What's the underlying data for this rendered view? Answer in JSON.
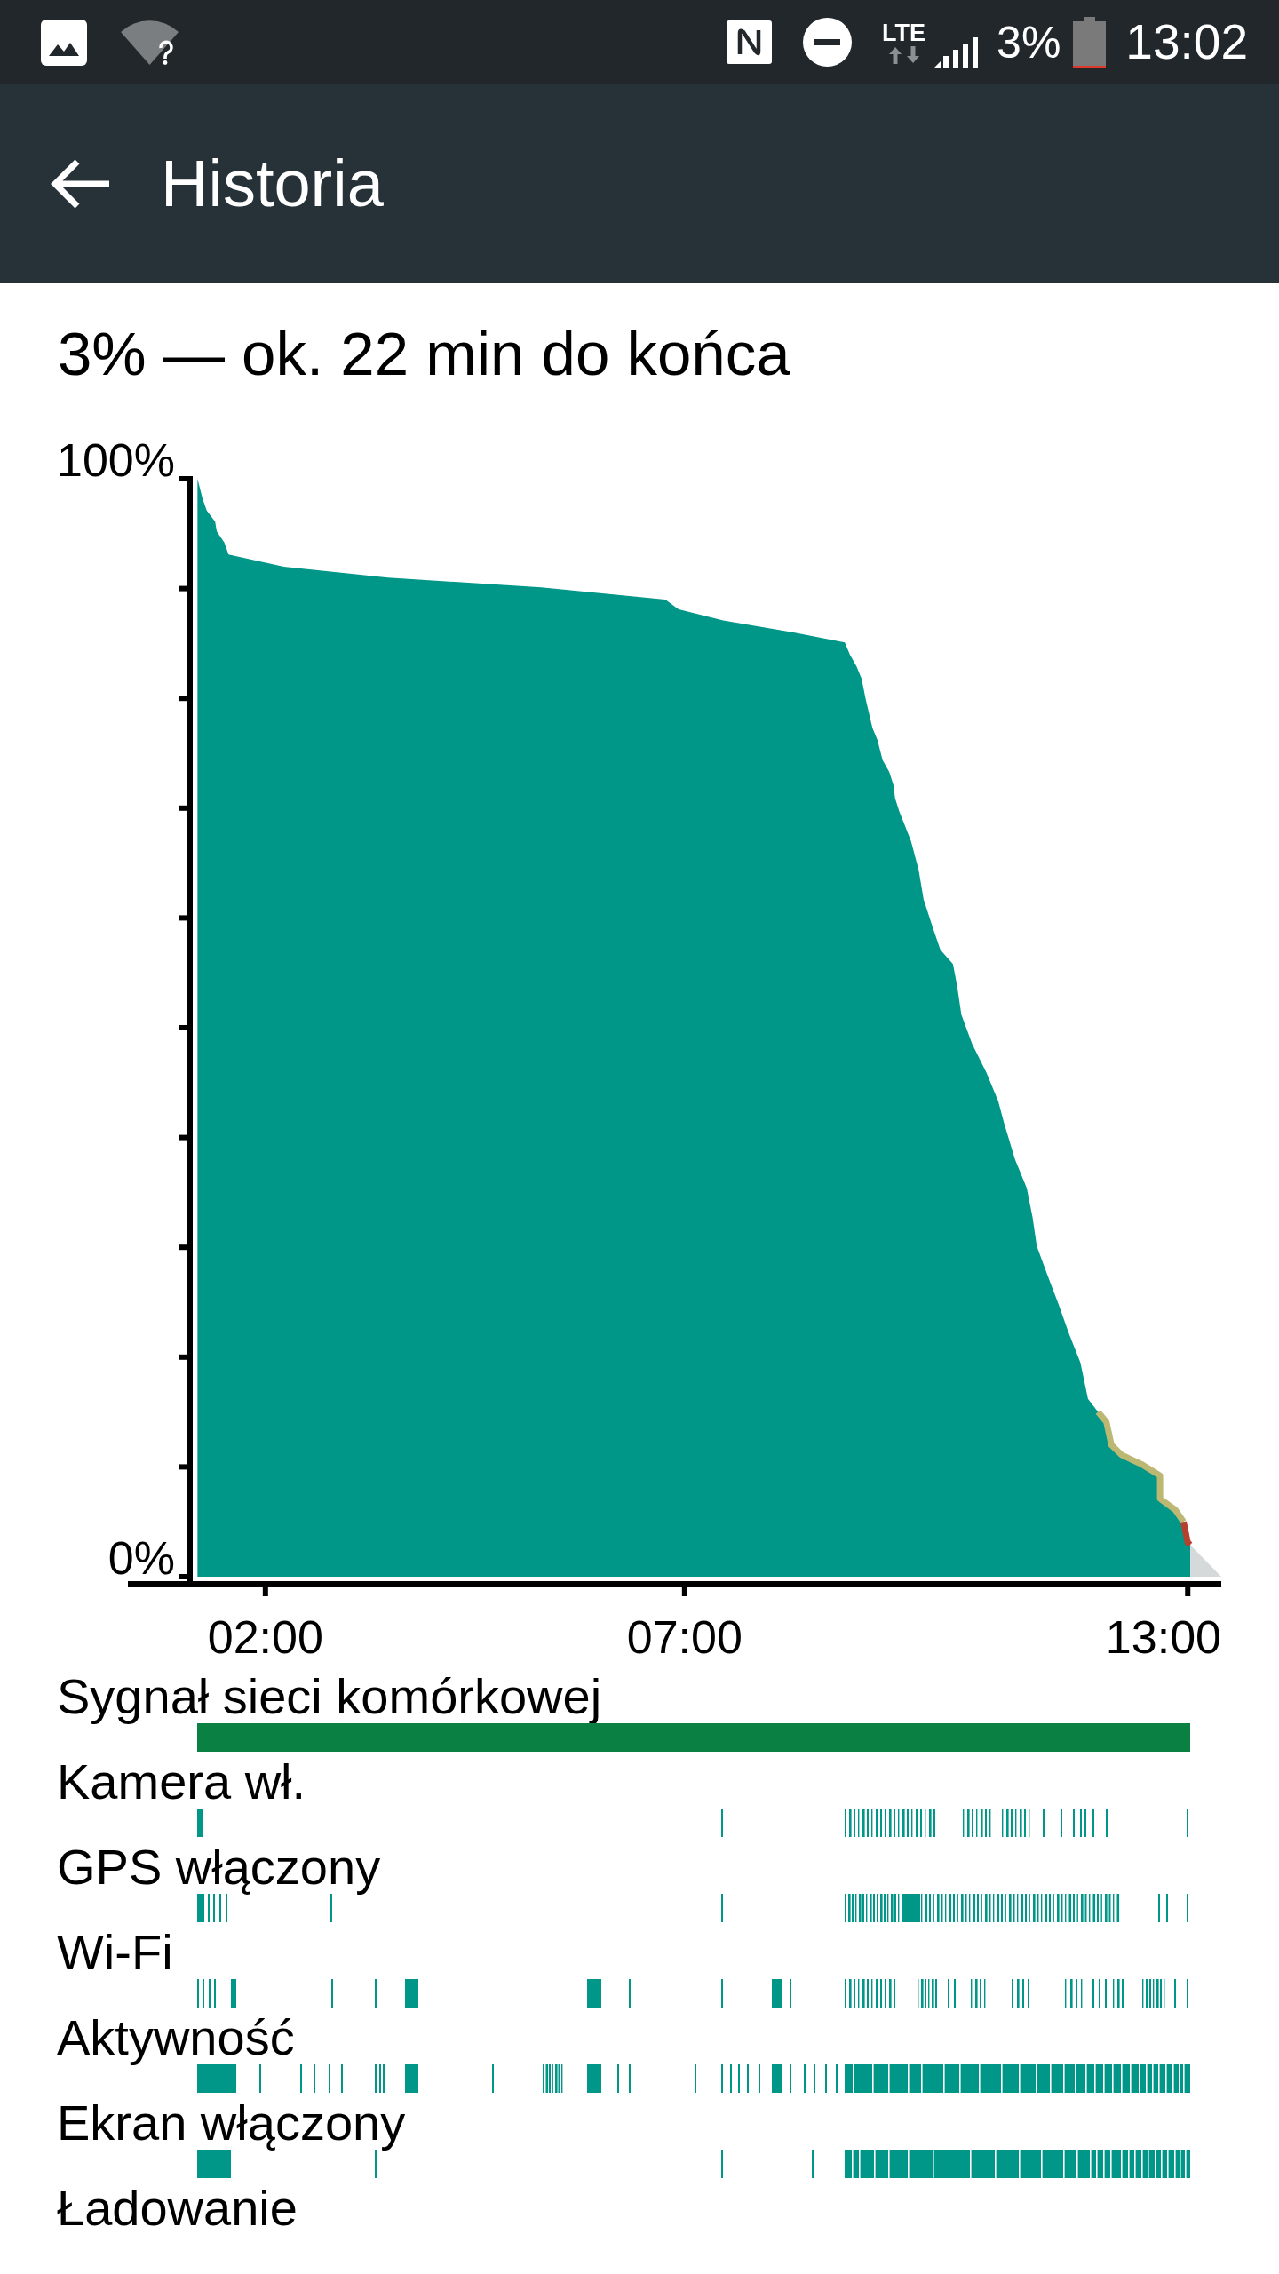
{
  "status_bar": {
    "network_type": "LTE",
    "battery_percent": "3%",
    "time": "13:02"
  },
  "app_bar": {
    "title": "Historia"
  },
  "summary": "3% — ok. 22 min do końca",
  "chart": {
    "chart_data": {
      "type": "area",
      "x": [
        1.19,
        1.25,
        1.3,
        1.4,
        1.42,
        1.51,
        1.56,
        2.22,
        3.46,
        5.29,
        6.77,
        6.93,
        7.46,
        8.3,
        8.91,
        8.97,
        9.05,
        9.11,
        9.16,
        9.24,
        9.3,
        9.36,
        9.44,
        9.49,
        9.51,
        9.56,
        9.7,
        9.79,
        9.85,
        9.96,
        10.05,
        10.2,
        10.25,
        10.3,
        10.43,
        10.6,
        10.74,
        10.81,
        10.94,
        11.08,
        11.15,
        11.2,
        11.33,
        11.46,
        11.58,
        11.72,
        11.81,
        11.93,
        12.03,
        12.09,
        12.21,
        12.46,
        12.67,
        12.67,
        12.85,
        12.95,
        13.0,
        13.03,
        13.4
      ],
      "series": [
        {
          "type": "area",
          "color": "#009688",
          "values": [
            100,
            98.2,
            97.1,
            96.1,
            95.2,
            94.2,
            93.1,
            92.0,
            91.0,
            90.1,
            89.0,
            88.1,
            87.1,
            86.0,
            85.1,
            84.0,
            82.9,
            81.8,
            79.9,
            77.3,
            76.2,
            74.4,
            73.3,
            72.1,
            70.9,
            69.7,
            67.0,
            64.4,
            61.7,
            59.1,
            57.1,
            55.8,
            53.8,
            51.2,
            48.5,
            45.9,
            43.3,
            41.3,
            38.0,
            35.4,
            32.7,
            30.1,
            27.4,
            24.8,
            22.2,
            19.5,
            16.2,
            15.0,
            14.1,
            12.0,
            11.1,
            10.2,
            9.2,
            7.1,
            6.1,
            5.0,
            3.1,
            2.9,
            null
          ]
        },
        {
          "type": "line",
          "color": "#bcb873",
          "values": [
            null,
            null,
            null,
            null,
            null,
            null,
            null,
            null,
            null,
            null,
            null,
            null,
            null,
            null,
            null,
            null,
            null,
            null,
            null,
            null,
            null,
            null,
            null,
            null,
            null,
            null,
            null,
            null,
            null,
            null,
            null,
            null,
            null,
            null,
            null,
            null,
            null,
            null,
            null,
            null,
            null,
            null,
            null,
            null,
            null,
            null,
            null,
            15.0,
            14.1,
            12.0,
            11.1,
            10.2,
            9.2,
            7.1,
            6.1,
            5.0,
            null,
            null,
            null
          ]
        },
        {
          "type": "line",
          "color": "#b5402e",
          "values": [
            null,
            null,
            null,
            null,
            null,
            null,
            null,
            null,
            null,
            null,
            null,
            null,
            null,
            null,
            null,
            null,
            null,
            null,
            null,
            null,
            null,
            null,
            null,
            null,
            null,
            null,
            null,
            null,
            null,
            null,
            null,
            null,
            null,
            null,
            null,
            null,
            null,
            null,
            null,
            null,
            null,
            null,
            null,
            null,
            null,
            null,
            null,
            null,
            null,
            null,
            null,
            null,
            null,
            null,
            null,
            5.0,
            3.1,
            2.9,
            null
          ]
        },
        {
          "type": "area",
          "color": "#d5d9da",
          "values": [
            null,
            null,
            null,
            null,
            null,
            null,
            null,
            null,
            null,
            null,
            null,
            null,
            null,
            null,
            null,
            null,
            null,
            null,
            null,
            null,
            null,
            null,
            null,
            null,
            null,
            null,
            null,
            null,
            null,
            null,
            null,
            null,
            null,
            null,
            null,
            null,
            null,
            null,
            null,
            null,
            null,
            null,
            null,
            null,
            null,
            null,
            null,
            null,
            null,
            null,
            null,
            null,
            null,
            null,
            null,
            null,
            null,
            2.9,
            0
          ]
        }
      ],
      "xlim": [
        0.36,
        13.4
      ],
      "ylim": [
        0,
        100
      ],
      "xticks": [
        {
          "value": 2,
          "label": "02:00"
        },
        {
          "value": 7,
          "label": "07:00"
        },
        {
          "value": 13,
          "label": "13:00"
        }
      ],
      "yticks": [
        {
          "value": 0,
          "label": "0%"
        },
        {
          "value": 100,
          "label": "100%"
        }
      ]
    }
  },
  "tracks": [
    {
      "label": "Sygnał sieci komórkowej",
      "color": "#0b8043"
    },
    {
      "label": "Kamera wł.",
      "color": "#009688"
    },
    {
      "label": "GPS włączony",
      "color": "#009688"
    },
    {
      "label": "Wi-Fi",
      "color": "#009688"
    },
    {
      "label": "Aktywność",
      "color": "#009688"
    },
    {
      "label": "Ekran włączony",
      "color": "#009688"
    },
    {
      "label": "Ładowanie"
    }
  ]
}
